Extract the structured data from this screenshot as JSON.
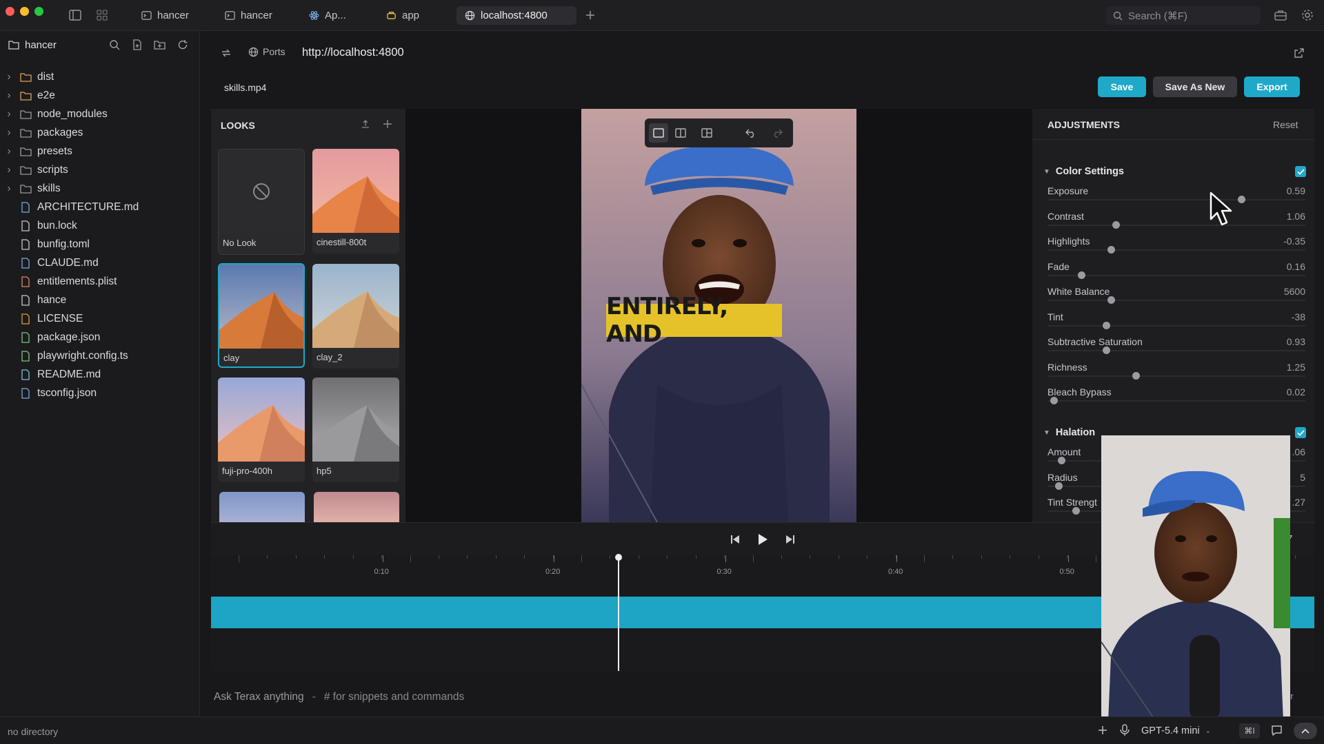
{
  "titlebar": {
    "tabs": [
      {
        "label": "hancer",
        "icon": "terminal-icon"
      },
      {
        "label": "hancer",
        "icon": "terminal-icon"
      },
      {
        "label": "Ap...",
        "icon": "react-icon"
      },
      {
        "label": "app",
        "icon": "app-icon"
      },
      {
        "label": "localhost:4800",
        "icon": "globe-icon"
      }
    ],
    "search_placeholder": "Search (⌘F)"
  },
  "sidebar": {
    "root": "hancer",
    "items": [
      {
        "label": "dist",
        "type": "folder",
        "icon_color": "#e0a060"
      },
      {
        "label": "e2e",
        "type": "folder",
        "icon_color": "#e0a060"
      },
      {
        "label": "node_modules",
        "type": "folder",
        "icon_color": "#9a9aa0"
      },
      {
        "label": "packages",
        "type": "folder",
        "icon_color": "#9a9aa0"
      },
      {
        "label": "presets",
        "type": "folder",
        "icon_color": "#9a9aa0"
      },
      {
        "label": "scripts",
        "type": "folder",
        "icon_color": "#9a9aa0"
      },
      {
        "label": "skills",
        "type": "folder",
        "icon_color": "#9a9aa0"
      },
      {
        "label": "ARCHITECTURE.md",
        "type": "file",
        "icon_color": "#7aa8d8"
      },
      {
        "label": "bun.lock",
        "type": "file",
        "icon_color": "#c8c8cc"
      },
      {
        "label": "bunfig.toml",
        "type": "file",
        "icon_color": "#c8c8cc"
      },
      {
        "label": "CLAUDE.md",
        "type": "file",
        "icon_color": "#7aa8d8"
      },
      {
        "label": "entitlements.plist",
        "type": "file",
        "icon_color": "#d88860"
      },
      {
        "label": "hance",
        "type": "file",
        "icon_color": "#c8c8cc"
      },
      {
        "label": "LICENSE",
        "type": "file",
        "icon_color": "#d8a040"
      },
      {
        "label": "package.json",
        "type": "file",
        "icon_color": "#80c080"
      },
      {
        "label": "playwright.config.ts",
        "type": "file",
        "icon_color": "#80c080"
      },
      {
        "label": "README.md",
        "type": "file",
        "icon_color": "#80c0d0"
      },
      {
        "label": "tsconfig.json",
        "type": "file",
        "icon_color": "#7aa8d8"
      }
    ]
  },
  "browser": {
    "ports_label": "Ports",
    "url": "http://localhost:4800"
  },
  "editor": {
    "filename": "skills.mp4",
    "save_label": "Save",
    "save_as_new_label": "Save As New",
    "export_label": "Export",
    "accent": "#1fa9c9"
  },
  "looks": {
    "title": "LOOKS",
    "items": [
      {
        "label": "No Look",
        "style": "none"
      },
      {
        "label": "cinestill-800t",
        "style": "pink"
      },
      {
        "label": "clay",
        "style": "clay",
        "selected": true
      },
      {
        "label": "clay_2",
        "style": "clay2"
      },
      {
        "label": "fuji-pro-400h",
        "style": "fuji"
      },
      {
        "label": "hp5",
        "style": "mono"
      }
    ]
  },
  "video": {
    "caption": "ENTIRELY, AND"
  },
  "adjustments": {
    "title": "ADJUSTMENTS",
    "reset_label": "Reset",
    "color_settings": {
      "label": "Color Settings",
      "enabled": true,
      "rows": [
        {
          "name": "Exposure",
          "value": "0.59",
          "level": 0.76
        },
        {
          "name": "Contrast",
          "value": "1.06",
          "level": 0.26
        },
        {
          "name": "Highlights",
          "value": "-0.35",
          "level": 0.24
        },
        {
          "name": "Fade",
          "value": "0.16",
          "level": 0.12
        },
        {
          "name": "White Balance",
          "value": "5600",
          "level": 0.24
        },
        {
          "name": "Tint",
          "value": "-38",
          "level": 0.22
        },
        {
          "name": "Subtractive Saturation",
          "value": "0.93",
          "level": 0.22
        },
        {
          "name": "Richness",
          "value": "1.25",
          "level": 0.34
        },
        {
          "name": "Bleach Bypass",
          "value": "0.02",
          "level": 0.01
        }
      ]
    },
    "halation": {
      "label": "Halation",
      "enabled": true,
      "rows": [
        {
          "name": "Amount",
          "value": ".06",
          "level": 0.04
        },
        {
          "name": "Radius",
          "value": "5",
          "level": 0.03
        },
        {
          "name": "Tint Strengt",
          "value": ".27",
          "level": 0.1
        }
      ]
    }
  },
  "timeline": {
    "ticks": [
      "0:10",
      "0:20",
      "0:30",
      "0:40",
      "0:50"
    ],
    "time_fragment": "7",
    "playhead_progress": 0.37
  },
  "chat": {
    "placeholder_main": "Ask Terax anything",
    "separator": "-",
    "placeholder_hint": "# for snippets and commands",
    "model_fragment": "er"
  },
  "status": {
    "directory": "no directory",
    "model": "GPT-5.4 mini",
    "shortcut": "⌘I"
  }
}
